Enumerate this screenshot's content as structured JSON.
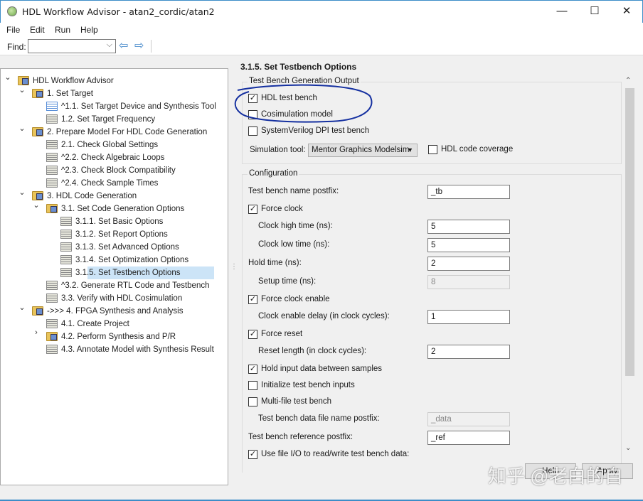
{
  "window": {
    "title": "HDL Workflow Advisor - atan2_cordic/atan2",
    "minimize": "—",
    "maximize": "☐",
    "close": "✕"
  },
  "menu": [
    "File",
    "Edit",
    "Run",
    "Help"
  ],
  "toolbar": {
    "find_label": "Find:",
    "find_value": "",
    "dropdown": "⌵",
    "back": "⇦",
    "forward": "⇨"
  },
  "tree": [
    {
      "label": "HDL Workflow Advisor",
      "level": 0,
      "icon": "folder",
      "chev": "⌄"
    },
    {
      "label": "1. Set Target",
      "level": 1,
      "icon": "folder",
      "chev": "⌄"
    },
    {
      "label": "^1.1. Set Target Device and Synthesis Tool",
      "level": 2,
      "icon": "task-blue"
    },
    {
      "label": "1.2. Set Target Frequency",
      "level": 2,
      "icon": "task"
    },
    {
      "label": "2. Prepare Model For HDL Code Generation",
      "level": 1,
      "icon": "folder",
      "chev": "⌄"
    },
    {
      "label": "2.1. Check Global Settings",
      "level": 2,
      "icon": "task"
    },
    {
      "label": "^2.2. Check Algebraic Loops",
      "level": 2,
      "icon": "task"
    },
    {
      "label": "^2.3. Check Block Compatibility",
      "level": 2,
      "icon": "task"
    },
    {
      "label": "^2.4. Check Sample Times",
      "level": 2,
      "icon": "task"
    },
    {
      "label": "3. HDL Code Generation",
      "level": 1,
      "icon": "folder",
      "chev": "⌄"
    },
    {
      "label": "3.1. Set Code Generation Options",
      "level": 2,
      "icon": "folder",
      "chev": "⌄"
    },
    {
      "label": "3.1.1. Set Basic Options",
      "level": 3,
      "icon": "task"
    },
    {
      "label": "3.1.2. Set Report Options",
      "level": 3,
      "icon": "task"
    },
    {
      "label": "3.1.3. Set Advanced Options",
      "level": 3,
      "icon": "task"
    },
    {
      "label": "3.1.4. Set Optimization Options",
      "level": 3,
      "icon": "task"
    },
    {
      "label": "3.1.5. Set Testbench Options",
      "level": 3,
      "icon": "task",
      "selected": true
    },
    {
      "label": "^3.2. Generate RTL Code and Testbench",
      "level": 2,
      "icon": "task"
    },
    {
      "label": "3.3. Verify with HDL Cosimulation",
      "level": 2,
      "icon": "task"
    },
    {
      "label": "->>> 4. FPGA Synthesis and Analysis",
      "level": 1,
      "icon": "folder",
      "chev": "⌄"
    },
    {
      "label": "4.1. Create Project",
      "level": 2,
      "icon": "task"
    },
    {
      "label": "4.2. Perform Synthesis and P/R",
      "level": 2,
      "icon": "folder",
      "chev": "›"
    },
    {
      "label": "4.3. Annotate Model with Synthesis Result",
      "level": 2,
      "icon": "task"
    }
  ],
  "panel": {
    "title": "3.1.5. Set Testbench Options",
    "output_group": "Test Bench Generation Output",
    "hdl_test_bench": {
      "label": "HDL test bench",
      "checked": true
    },
    "cosim_model": {
      "label": "Cosimulation model",
      "checked": false
    },
    "sv_dpi": {
      "label": "SystemVerilog DPI test bench",
      "checked": false
    },
    "sim_tool_label": "Simulation tool:",
    "sim_tool_value": "Mentor Graphics Modelsim",
    "hdl_coverage": {
      "label": "HDL code coverage",
      "checked": false
    },
    "config_group": "Configuration",
    "config": [
      {
        "type": "field",
        "label": "Test bench name postfix:",
        "value": "_tb",
        "indent": 0
      },
      {
        "type": "check",
        "label": "Force clock",
        "checked": true
      },
      {
        "type": "field",
        "label": "Clock high time (ns):",
        "value": "5",
        "indent": 1
      },
      {
        "type": "field",
        "label": "Clock low time (ns):",
        "value": "5",
        "indent": 1
      },
      {
        "type": "field",
        "label": "Hold time (ns):",
        "value": "2",
        "indent": 0
      },
      {
        "type": "field",
        "label": "Setup time (ns):",
        "value": "8",
        "indent": 1,
        "disabled": true
      },
      {
        "type": "check",
        "label": "Force clock enable",
        "checked": true
      },
      {
        "type": "field",
        "label": "Clock enable delay (in clock cycles):",
        "value": "1",
        "indent": 1
      },
      {
        "type": "check",
        "label": "Force reset",
        "checked": true
      },
      {
        "type": "field",
        "label": "Reset length (in clock cycles):",
        "value": "2",
        "indent": 1
      },
      {
        "type": "check",
        "label": "Hold input data between samples",
        "checked": true
      },
      {
        "type": "check",
        "label": "Initialize test bench inputs",
        "checked": false
      },
      {
        "type": "check",
        "label": "Multi-file test bench",
        "checked": false
      },
      {
        "type": "field",
        "label": "Test bench data file name postfix:",
        "value": "_data",
        "indent": 1,
        "disabled": true
      },
      {
        "type": "field",
        "label": "Test bench reference postfix:",
        "value": "_ref",
        "indent": 0
      },
      {
        "type": "check",
        "label": "Use file I/O to read/write test bench data:",
        "checked": true
      }
    ]
  },
  "buttons": {
    "help": "Help",
    "apply": "Apply"
  },
  "watermark": "知乎 @老白的自",
  "colors": {
    "annotation": "#1530a0",
    "selection": "#cce4f7"
  }
}
